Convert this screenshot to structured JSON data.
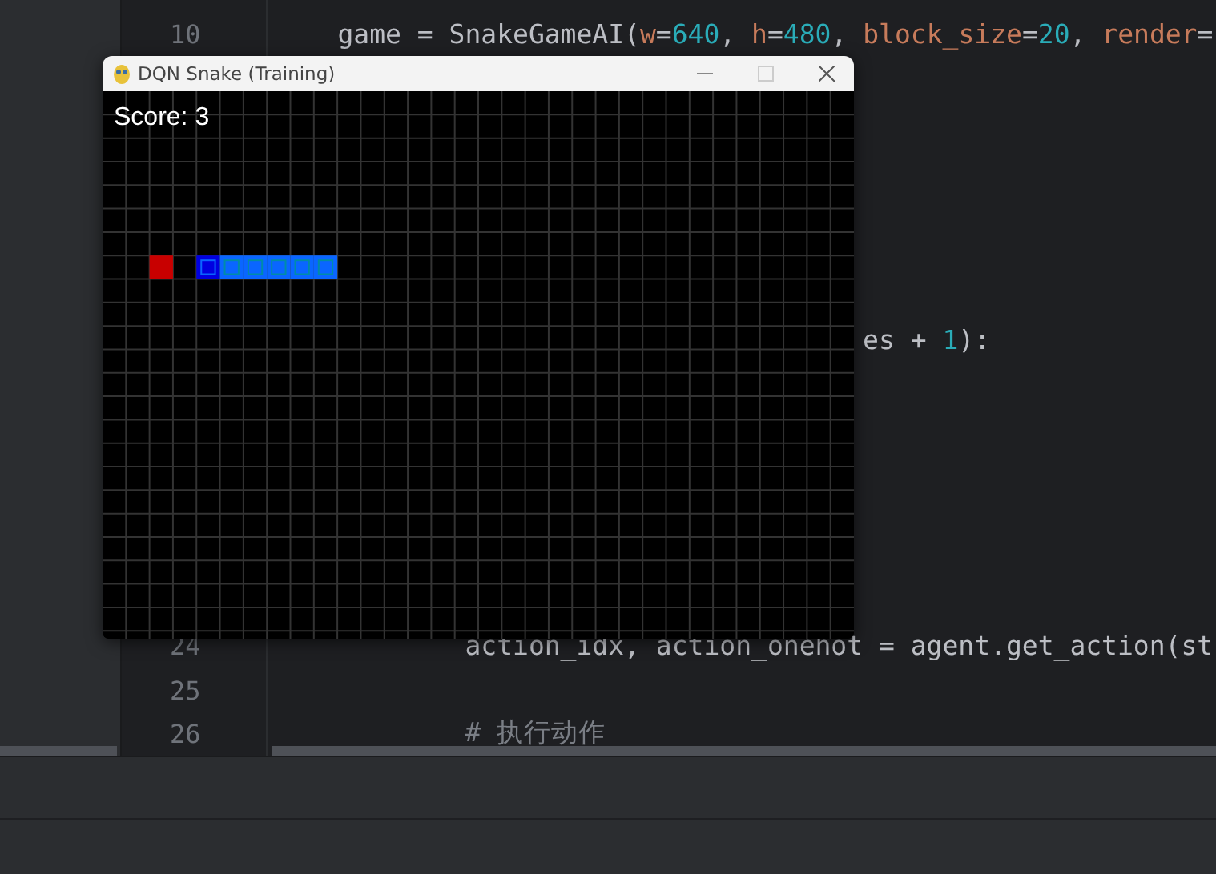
{
  "editor": {
    "lines": [
      {
        "number": "10",
        "tokens": [
          {
            "kind": "plain",
            "text": "    game = SnakeGameAI("
          },
          {
            "kind": "param",
            "text": "w"
          },
          {
            "kind": "plain",
            "text": "="
          },
          {
            "kind": "number",
            "text": "640"
          },
          {
            "kind": "plain",
            "text": ", "
          },
          {
            "kind": "param",
            "text": "h"
          },
          {
            "kind": "plain",
            "text": "="
          },
          {
            "kind": "number",
            "text": "480"
          },
          {
            "kind": "plain",
            "text": ", "
          },
          {
            "kind": "param",
            "text": "block_size"
          },
          {
            "kind": "plain",
            "text": "="
          },
          {
            "kind": "number",
            "text": "20"
          },
          {
            "kind": "plain",
            "text": ", "
          },
          {
            "kind": "param",
            "text": "render"
          },
          {
            "kind": "plain",
            "text": "="
          }
        ]
      },
      {
        "tokens": [
          {
            "kind": "plain",
            "text": "                                     es + "
          },
          {
            "kind": "number",
            "text": "1"
          },
          {
            "kind": "plain",
            "text": "):"
          }
        ]
      },
      {
        "number": "24",
        "tokens": [
          {
            "kind": "plain",
            "text": "            action_idx, action_onehot = agent.get_action(st"
          }
        ]
      },
      {
        "number": "25"
      },
      {
        "number": "26",
        "tokens": [
          {
            "kind": "comment",
            "text": "            # 执行动作"
          }
        ]
      }
    ]
  },
  "game_window": {
    "title": "DQN Snake (Training)",
    "score": "Score: 3"
  }
}
